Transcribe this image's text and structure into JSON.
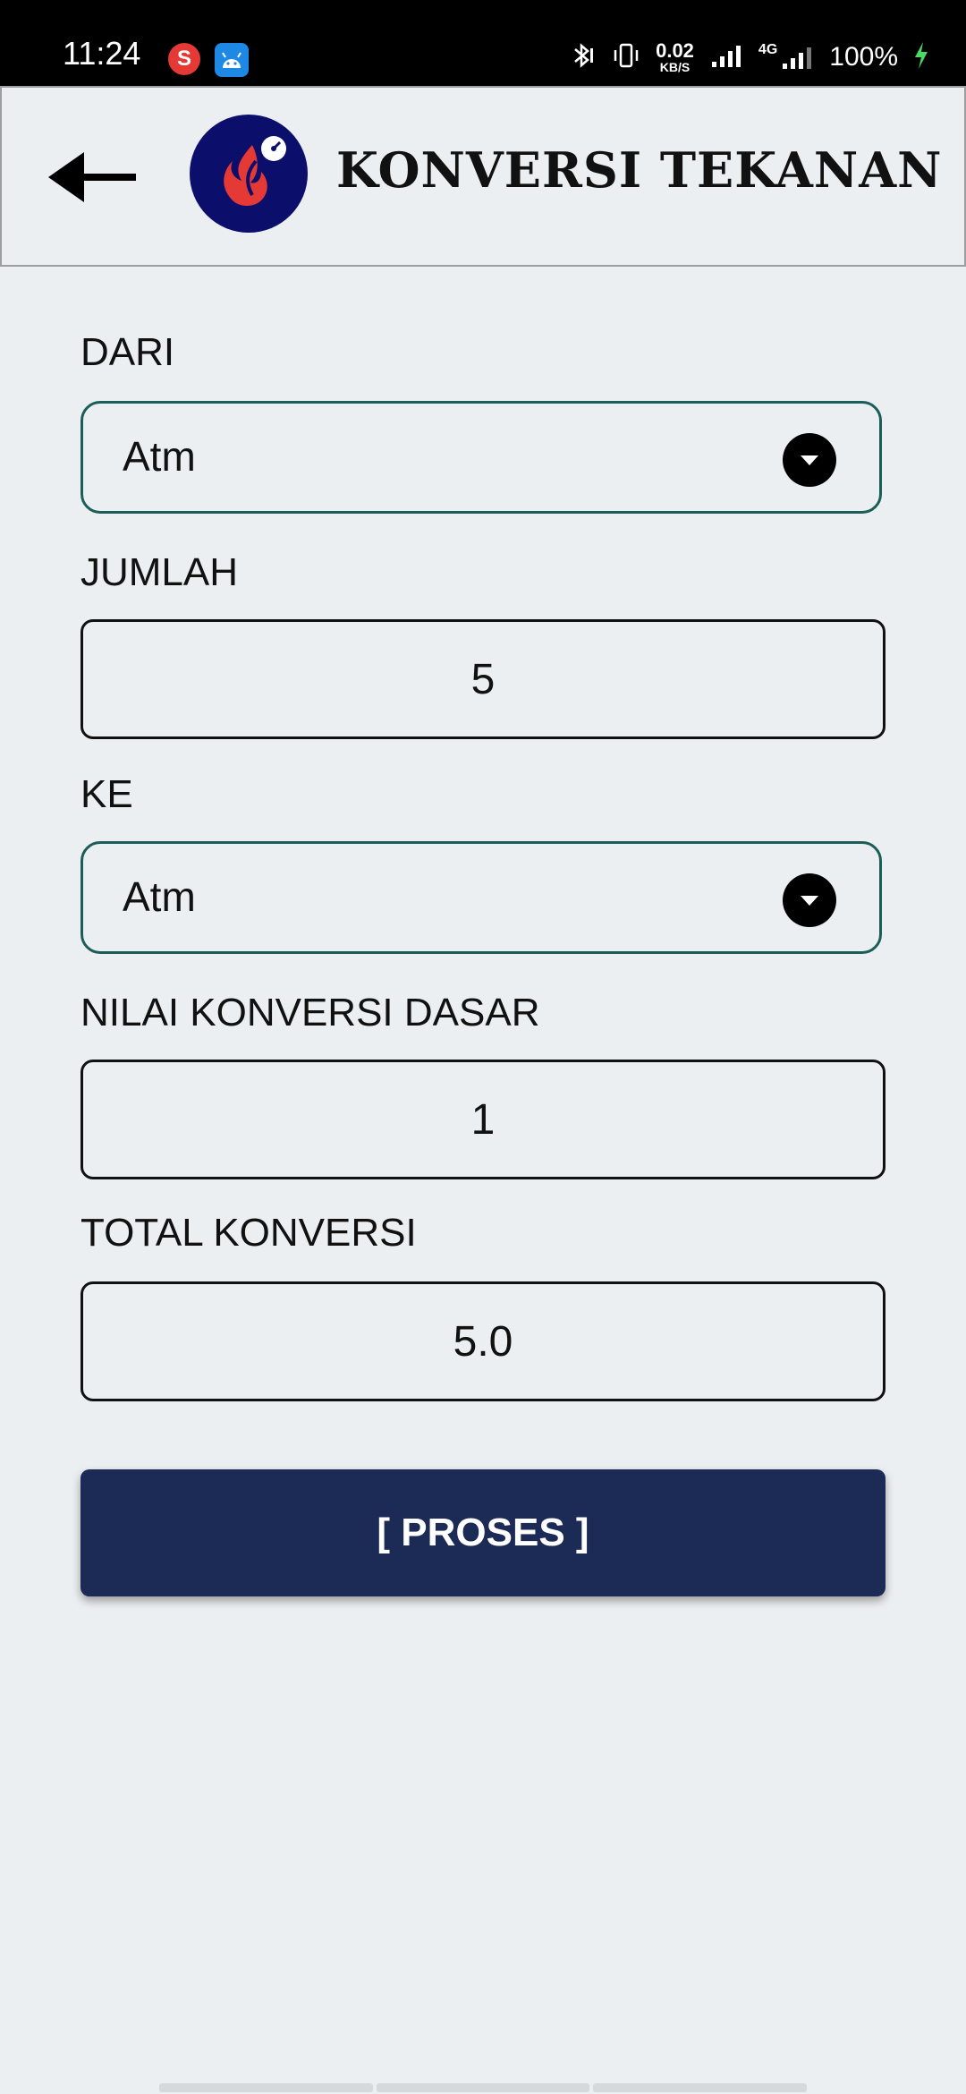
{
  "status_bar": {
    "time": "11:24",
    "notification_1_letter": "S",
    "net_speed_value": "0.02",
    "net_speed_unit": "KB/S",
    "network_type": "4G",
    "battery": "100%"
  },
  "app_bar": {
    "title": "KONVERSI TEKANAN"
  },
  "form": {
    "from_label": "DARI",
    "from_value": "Atm",
    "amount_label": "JUMLAH",
    "amount_value": "5",
    "to_label": "KE",
    "to_value": "Atm",
    "base_label": "NILAI KONVERSI DASAR",
    "base_value": "1",
    "total_label": "TOTAL KONVERSI",
    "total_value": "5.0"
  },
  "button": {
    "process_label": "[ PROSES ]"
  },
  "colors": {
    "background": "#eceff1",
    "button": "#1c2a56",
    "select_border": "#1b5e57",
    "logo_background": "#0b0f6b",
    "logo_flame": "#e53935"
  }
}
